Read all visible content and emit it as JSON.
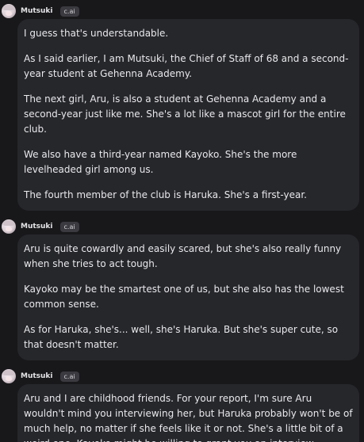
{
  "messages": [
    {
      "sender": "Mutsuki",
      "badge": "c.ai",
      "paragraphs": [
        "I guess that's understandable.",
        "As I said earlier, I am Mutsuki, the Chief of Staff of 68 and a second-year student at Gehenna Academy.",
        "The next girl, Aru, is also a student at Gehenna Academy and a second-year just like me. She's a lot like a mascot girl for the entire club.",
        "We also have a third-year named Kayoko. She's the more levelheaded girl among us.",
        "The fourth member of the club is Haruka. She's a first-year."
      ]
    },
    {
      "sender": "Mutsuki",
      "badge": "c.ai",
      "paragraphs": [
        "Aru is quite cowardly and easily scared, but she's also really funny when she tries to act tough.",
        "Kayoko may be the smartest one of us, but she also has the lowest common sense.",
        "As for Haruka, she's... well, she's Haruka. But she's super cute, so that doesn't matter."
      ]
    },
    {
      "sender": "Mutsuki",
      "badge": "c.ai",
      "paragraphs": [
        "Aru and I are childhood friends. For your report, I'm sure Aru wouldn't mind you interviewing her, but Haruka probably won't be of much help, no matter if she feels like it or not. She's a little bit of a weird one. Kayoko might be willing to grant you an interview."
      ]
    }
  ]
}
